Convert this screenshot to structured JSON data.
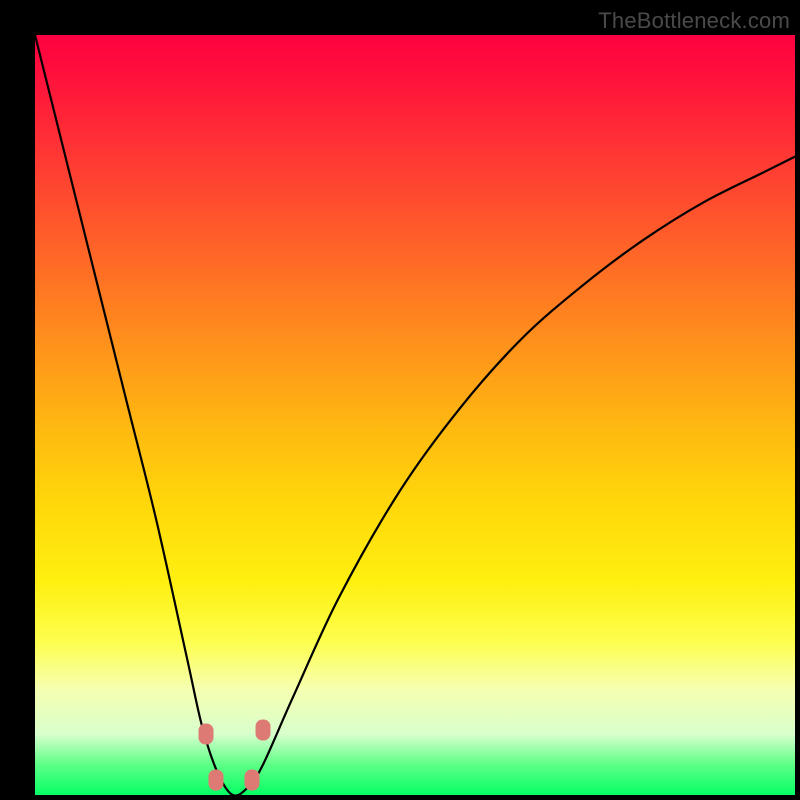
{
  "watermark": "TheBottleneck.com",
  "colors": {
    "frame": "#000000",
    "curve": "#000000",
    "marker": "#de7a74"
  },
  "chart_data": {
    "type": "line",
    "title": "",
    "xlabel": "",
    "ylabel": "",
    "xlim": [
      0,
      100
    ],
    "ylim": [
      0,
      100
    ],
    "grid": false,
    "legend": false,
    "note": "Axes unlabeled. Background vertical gradient encodes value: top=red≈100 (worst), bottom=green≈0 (best). Curve shows a V-shaped bottleneck profile with minimum near x≈26 reaching y≈0.",
    "series": [
      {
        "name": "bottleneck",
        "x": [
          0,
          4,
          8,
          12,
          16,
          20,
          22,
          24,
          26,
          28,
          30,
          34,
          40,
          48,
          56,
          64,
          72,
          80,
          88,
          96,
          100
        ],
        "y": [
          100,
          84,
          68,
          52,
          36,
          18,
          9,
          3,
          0,
          1,
          4,
          13,
          26,
          40,
          51,
          60,
          67,
          73,
          78,
          82,
          84
        ]
      }
    ],
    "markers": [
      {
        "x": 22.5,
        "y": 8.0
      },
      {
        "x": 30.0,
        "y": 8.5
      },
      {
        "x": 23.8,
        "y": 2.0
      },
      {
        "x": 28.5,
        "y": 2.0
      }
    ]
  }
}
